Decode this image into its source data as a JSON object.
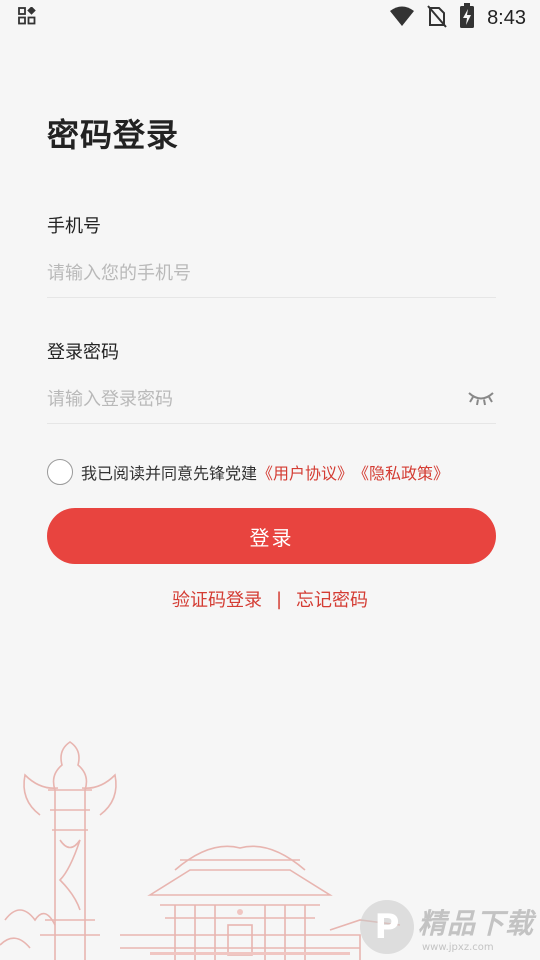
{
  "status_bar": {
    "time": "8:43",
    "icons": [
      "app-grid-icon",
      "wifi-icon",
      "no-sim-icon",
      "battery-charging-icon"
    ]
  },
  "page": {
    "title": "密码登录"
  },
  "phone": {
    "label": "手机号",
    "placeholder": "请输入您的手机号",
    "value": ""
  },
  "password": {
    "label": "登录密码",
    "placeholder": "请输入登录密码",
    "value": "",
    "toggle_icon": "eye-closed-icon"
  },
  "agreement": {
    "checked": false,
    "text": "我已阅读并同意先锋党建",
    "user_agreement": "《用户协议》",
    "privacy_policy": "《隐私政策》"
  },
  "login_button": {
    "label": "登录"
  },
  "links": {
    "sms_login": "验证码登录",
    "separator": "|",
    "forgot_password": "忘记密码"
  },
  "watermark": {
    "badge": "P",
    "name": "精品下载",
    "url": "www.jpxz.com"
  },
  "colors": {
    "accent": "#e8443f",
    "link": "#d43c33",
    "background": "#f6f6f6",
    "placeholder": "#b9b9b9"
  }
}
